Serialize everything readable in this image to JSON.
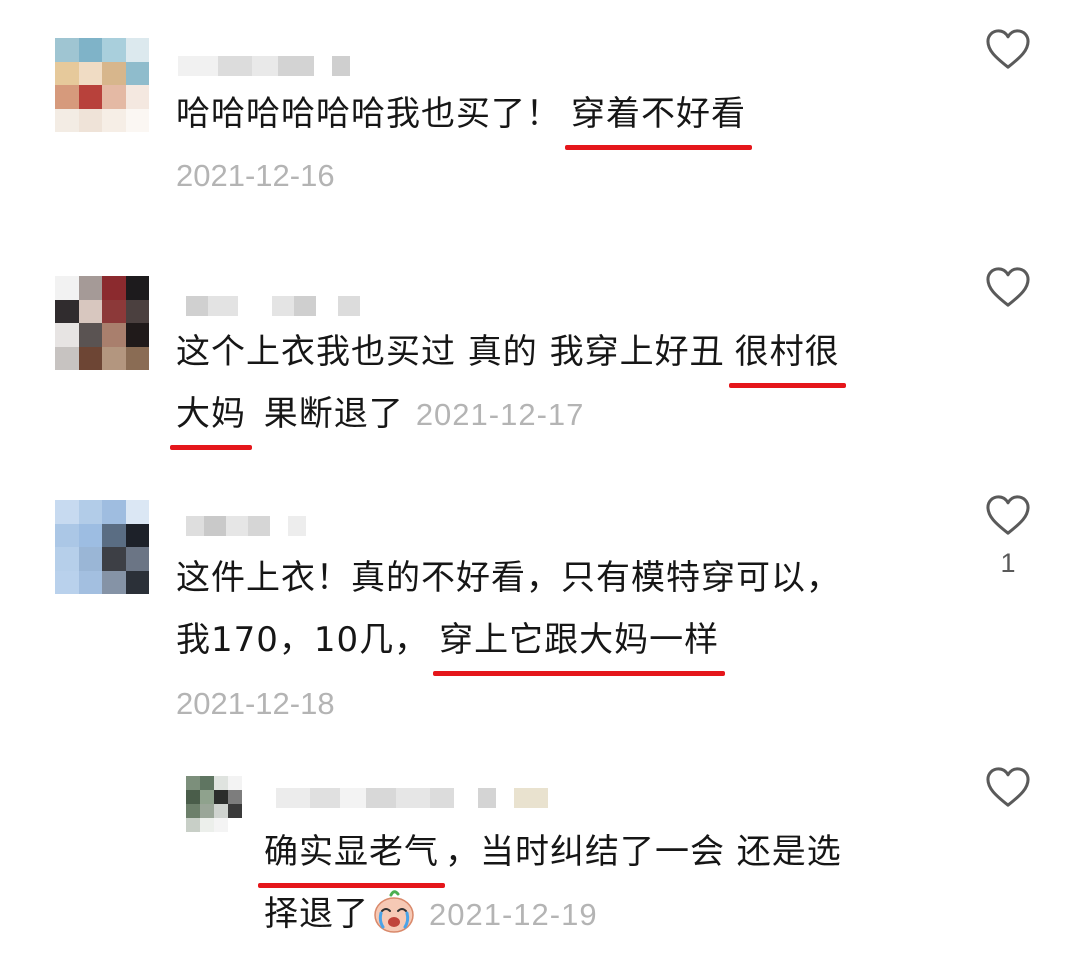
{
  "comments": [
    {
      "segments": [
        {
          "text": "哈哈哈哈哈哈我也买了！",
          "highlight": false
        },
        {
          "text": "穿着不好看",
          "highlight": true
        }
      ],
      "time": "2021-12-16"
    },
    {
      "line1": [
        {
          "text": "这个上衣我也买过 真的 我穿上好丑",
          "highlight": false
        },
        {
          "text": "很村很",
          "highlight": true
        }
      ],
      "line2": [
        {
          "text": "大妈",
          "highlight": true
        },
        {
          "text": " 果断退了",
          "highlight": false
        }
      ],
      "time": "2021-12-17"
    },
    {
      "line1": [
        {
          "text": "这件上衣！真的不好看，只有模特穿可以，",
          "highlight": false
        }
      ],
      "line2": [
        {
          "text": "我170，10几，",
          "highlight": false
        },
        {
          "text": "穿上它跟大妈一样",
          "highlight": true
        }
      ],
      "time": "2021-12-18",
      "likes": "1"
    },
    {
      "line1": [
        {
          "text": "确实显老气",
          "highlight": true
        },
        {
          "text": "，当时纠结了一会 还是选",
          "highlight": false
        }
      ],
      "line2": [
        {
          "text": "择退了",
          "highlight": false
        }
      ],
      "emoji": "crying-face-emoji",
      "time": "2021-12-19"
    }
  ],
  "colors": {
    "highlight_underline": "#e5161b",
    "timestamp": "#b4b4b4",
    "text": "#161616"
  },
  "icons": {
    "like": "heart-outline-icon",
    "emoji": "crying-face-emoji"
  }
}
